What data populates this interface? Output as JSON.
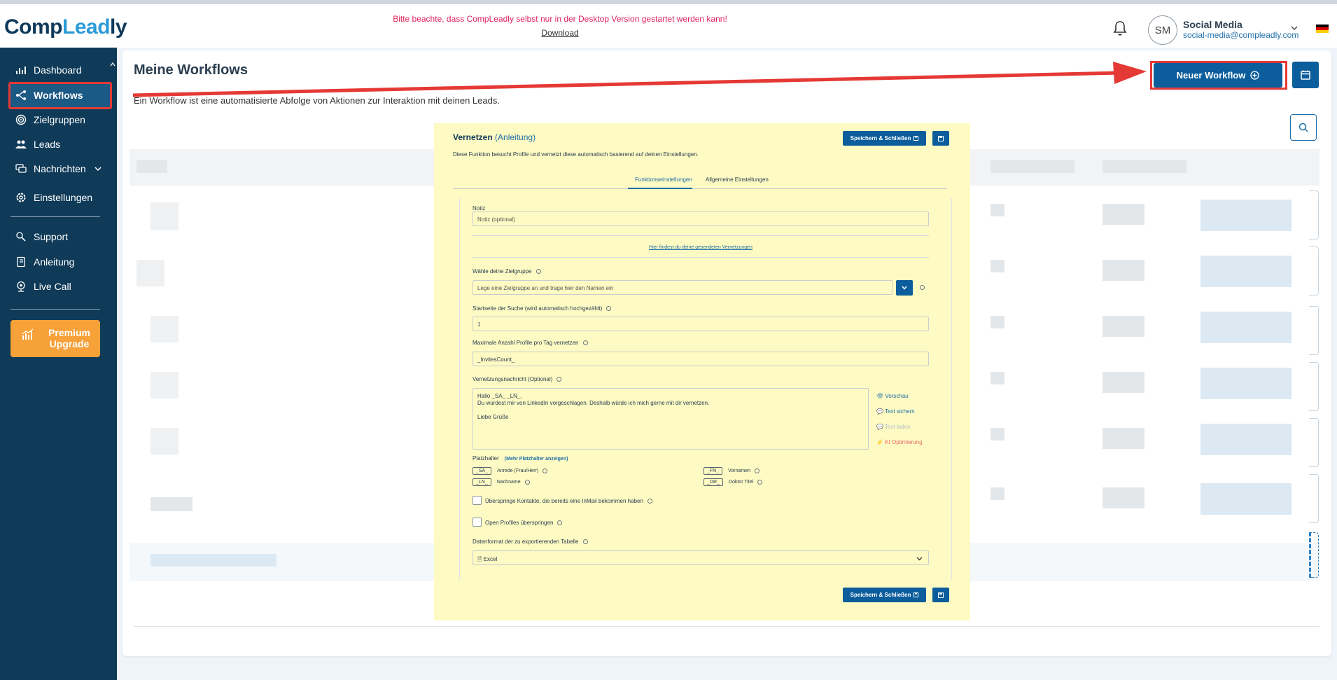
{
  "app": {
    "logo_part1": "Comp",
    "logo_part2": "Lead",
    "logo_part3": "ly",
    "notice": "Bitte beachte, dass CompLeadly selbst nur in der Desktop Version gestartet werden kann!",
    "download": "Download",
    "user_initials": "SM",
    "user_name": "Social Media",
    "user_email": "social-media@compleadly.com"
  },
  "sidebar": {
    "items": [
      {
        "label": "Dashboard",
        "icon": "chart-icon"
      },
      {
        "label": "Workflows",
        "icon": "workflow-icon"
      },
      {
        "label": "Zielgruppen",
        "icon": "target-icon"
      },
      {
        "label": "Leads",
        "icon": "users-icon"
      },
      {
        "label": "Nachrichten",
        "icon": "messages-icon"
      },
      {
        "label": "Einstellungen",
        "icon": "gear-icon"
      },
      {
        "label": "Support",
        "icon": "support-icon"
      },
      {
        "label": "Anleitung",
        "icon": "book-icon"
      },
      {
        "label": "Live Call",
        "icon": "webcam-icon"
      }
    ],
    "premium_line1": "Premium",
    "premium_line2": "Upgrade"
  },
  "main": {
    "title": "Meine Workflows",
    "subtitle": "Ein Workflow ist eine automatisierte Abfolge von Aktionen zur Interaktion mit deinen Leads.",
    "new_workflow": "Neuer Workflow"
  },
  "dialog": {
    "title": "Vernetzen",
    "title_link": "(Anleitung)",
    "description": "Diese Funktion besucht Profile und vernetzt diese automatisch basierend auf deinen Einstellungen.",
    "save_close": "Speichern & Schließen",
    "tabs": [
      "Funktionseinstellungen",
      "Allgemeine Einstellungen"
    ],
    "note_label": "Notiz",
    "note_placeholder": "Notiz (optional)",
    "sent_link": "Hier findest du deine gesendeten Vernetzungen",
    "target_label": "Wähle deine Zielgruppe",
    "target_placeholder": "Lege eine Zielgruppe an und trage hier den Namen ein",
    "start_label": "Startseite der Suche (wird automatisch hochgezählt)",
    "start_value": "1",
    "max_label": "Maximale Anzahl Profile pro Tag vernetzen",
    "max_value": "_InvitesCount_",
    "message_label": "Vernetzungsnachricht (Optional)",
    "message_lines": [
      "Hallo _SA_ _LN_,",
      "Du wurdest mir von LinkedIn vorgeschlagen. Deshalb würde ich mich gerne mit dir vernetzen.",
      "",
      "Liebe Grüße"
    ],
    "actions": [
      "Vorschau",
      "Text sichern",
      "Text laden",
      "KI Optimierung"
    ],
    "placeholder_title": "Platzhalter",
    "placeholder_more": "(Mehr Platzhalter anzeigen)",
    "placeholders": [
      {
        "tag": "_SA_",
        "desc": "Anrede (Frau/Herr)"
      },
      {
        "tag": "_FN_",
        "desc": "Vornamen"
      },
      {
        "tag": "_LN_",
        "desc": "Nachname"
      },
      {
        "tag": "_DR_",
        "desc": "Doktor Titel"
      }
    ],
    "skip_inmail": "Überspringe Kontakte, die bereits eine InMail bekommen haben",
    "skip_open": "Open Profiles überspringen",
    "export_label": "Datenformat der zu exportierenden Tabelle",
    "export_value": "Excel"
  },
  "colors": {
    "sidebar": "#0f3a58",
    "accent": "#0c5d9c",
    "highlight": "#fdfac3",
    "annotation": "#e53935",
    "premium": "#f7a139"
  }
}
